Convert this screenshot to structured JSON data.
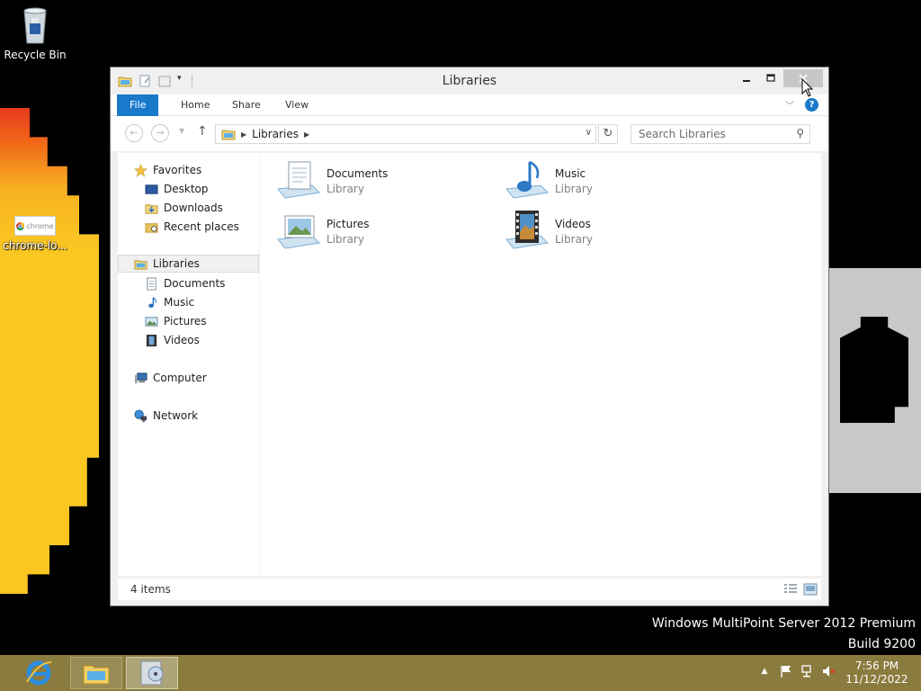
{
  "desktop": {
    "icons": [
      {
        "label": "Recycle Bin"
      },
      {
        "label": "chrome-lo...",
        "thumb_text": "chrome"
      }
    ],
    "watermark_line1": "Windows MultiPoint Server 2012 Premium",
    "watermark_line2": "Build 9200"
  },
  "window": {
    "title": "Libraries",
    "ribbon_tabs": [
      "File",
      "Home",
      "Share",
      "View"
    ],
    "help_label": "?",
    "address": {
      "crumb": "Libraries"
    },
    "search": {
      "placeholder": "Search Libraries"
    },
    "nav_pane": {
      "favorites": {
        "label": "Favorites",
        "items": [
          "Desktop",
          "Downloads",
          "Recent places"
        ]
      },
      "libraries": {
        "label": "Libraries",
        "items": [
          "Documents",
          "Music",
          "Pictures",
          "Videos"
        ]
      },
      "computer": {
        "label": "Computer"
      },
      "network": {
        "label": "Network"
      }
    },
    "libraries": [
      {
        "name": "Documents",
        "type": "Library",
        "icon": "documents-library-icon"
      },
      {
        "name": "Music",
        "type": "Library",
        "icon": "music-library-icon"
      },
      {
        "name": "Pictures",
        "type": "Library",
        "icon": "pictures-library-icon"
      },
      {
        "name": "Videos",
        "type": "Library",
        "icon": "videos-library-icon"
      }
    ],
    "status": {
      "item_count": "4 items"
    }
  },
  "taskbar": {
    "clock_time": "7:56 PM",
    "clock_date": "11/12/2022"
  },
  "colors": {
    "accent": "#1979ca",
    "taskbar": "#8a7b3e"
  }
}
